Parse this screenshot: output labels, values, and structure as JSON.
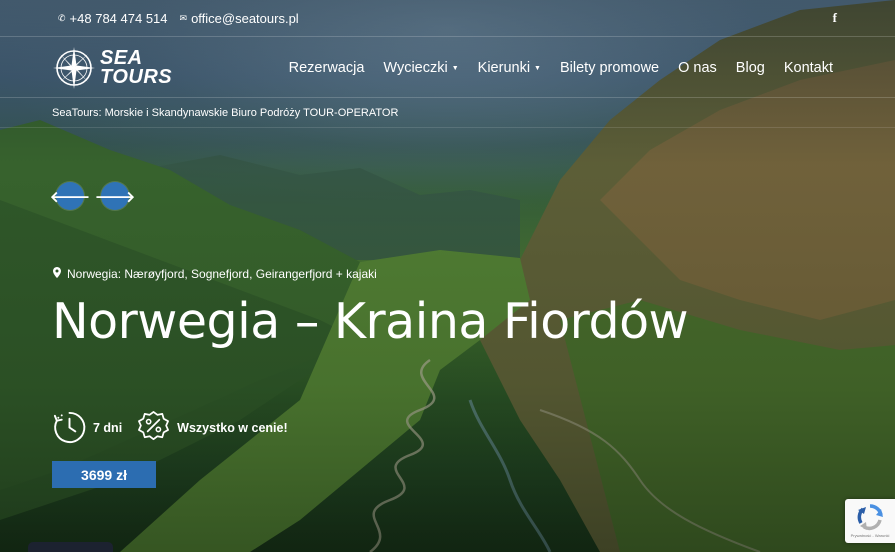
{
  "topbar": {
    "phone": "+48 784 474 514",
    "email": "office@seatours.pl",
    "phone_icon": "phone-icon",
    "email_icon": "envelope-icon",
    "social_icon": "facebook-icon",
    "social_glyph": "f"
  },
  "logo": {
    "line1": "SEA",
    "line2": "TOURS",
    "icon": "compass-rose-icon"
  },
  "nav": {
    "items": [
      {
        "label": "Rezerwacja",
        "dropdown": false
      },
      {
        "label": "Wycieczki",
        "dropdown": true
      },
      {
        "label": "Kierunki",
        "dropdown": true
      },
      {
        "label": "Bilety promowe",
        "dropdown": false
      },
      {
        "label": "O nas",
        "dropdown": false
      },
      {
        "label": "Blog",
        "dropdown": false
      },
      {
        "label": "Kontakt",
        "dropdown": false
      }
    ]
  },
  "tagline": "SeaTours: Morskie i Skandynawskie Biuro Podróży TOUR-OPERATOR",
  "slider": {
    "prev_icon": "arrow-left-icon",
    "next_icon": "arrow-right-icon"
  },
  "hero": {
    "location": "Norwegia: Nærøyfjord, Sognefjord, Geirangerfjord + kajaki",
    "title": "Norwegia – Kraina Fiordów",
    "duration": "7 dni",
    "included": "Wszystko w cenie!",
    "price": "3699 zł"
  },
  "recaptcha": {
    "text": "Prywatność - Warunki",
    "icon": "recaptcha-icon"
  },
  "colors": {
    "accent": "#2c6db1",
    "arrow_bg": "#2f73b6"
  }
}
